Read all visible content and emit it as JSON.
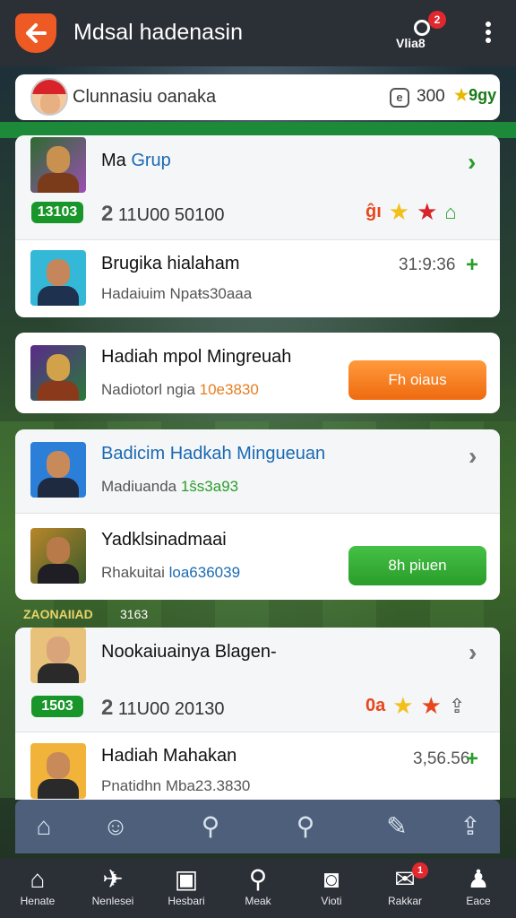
{
  "header": {
    "title": "Mdsal hadenasin",
    "notification_count": "2",
    "notification_label": "Vlia8"
  },
  "profile": {
    "name": "Clunnasiu oanaka",
    "coins": "300",
    "stars": "9gy"
  },
  "group_card": {
    "title_prefix": "Ma ",
    "title_accent": "Grup",
    "level_badge": "13103",
    "stat_big": "2",
    "stat_text": " 11U00 50100",
    "rating_text": "ĝı",
    "rows": [
      {
        "title": "Brugika hialaham",
        "subtitle": "Hadaiuim Npaŧs30aaa",
        "time": "31:9:36"
      }
    ]
  },
  "card_offer": {
    "title": "Hadiah mpol Mingreuah",
    "subtitle_prefix": "Nadiotorl ngia ",
    "subtitle_highlight": "10e3830",
    "button_label": "Fh oiaus"
  },
  "card_pair": {
    "rows": [
      {
        "title": "Badicim Hadkah Mingueuan",
        "subtitle_prefix": "Madiuanda ",
        "subtitle_highlight": "1ŝs3a93"
      },
      {
        "title": "Yadklsinadmaai",
        "subtitle_prefix": "Rhakuitai ",
        "subtitle_highlight": "loa636039",
        "button_label": "8h piuen"
      }
    ]
  },
  "section": {
    "label": "ZAONAIIAD",
    "count": "3163"
  },
  "card_bottom": {
    "title": "Nookaiuainya Blagen-",
    "level_badge": "1503",
    "stat_big": "2",
    "stat_text": " 11U00 20130",
    "rating_text": "0a",
    "row2_title": "Hadiah Mahakan",
    "row2_subtitle": "Pnatidhn Mba23.3830",
    "row2_time": "3,56.56"
  },
  "subnav": {
    "items": [
      "home-icon",
      "smiley-icon",
      "search-icon",
      "search-user-icon",
      "tag-icon",
      "share-icon"
    ]
  },
  "tabbar": {
    "tabs": [
      {
        "label": "Henate",
        "icon": "house-icon"
      },
      {
        "label": "Nenlesei",
        "icon": "plane-icon"
      },
      {
        "label": "Hesbari",
        "icon": "bag-icon"
      },
      {
        "label": "Meak",
        "icon": "search-icon"
      },
      {
        "label": "Vioti",
        "icon": "camera-icon"
      },
      {
        "label": "Rakkar",
        "icon": "mail-icon",
        "badge": "1"
      },
      {
        "label": "Eace",
        "icon": "person-icon"
      }
    ]
  },
  "colors": {
    "header_bg": "#2b2f36",
    "accent_orange": "#ee5a24",
    "accent_green": "#2a9d2a",
    "link_blue": "#1a6ab3",
    "subnav_bg": "#4d5f7a"
  }
}
